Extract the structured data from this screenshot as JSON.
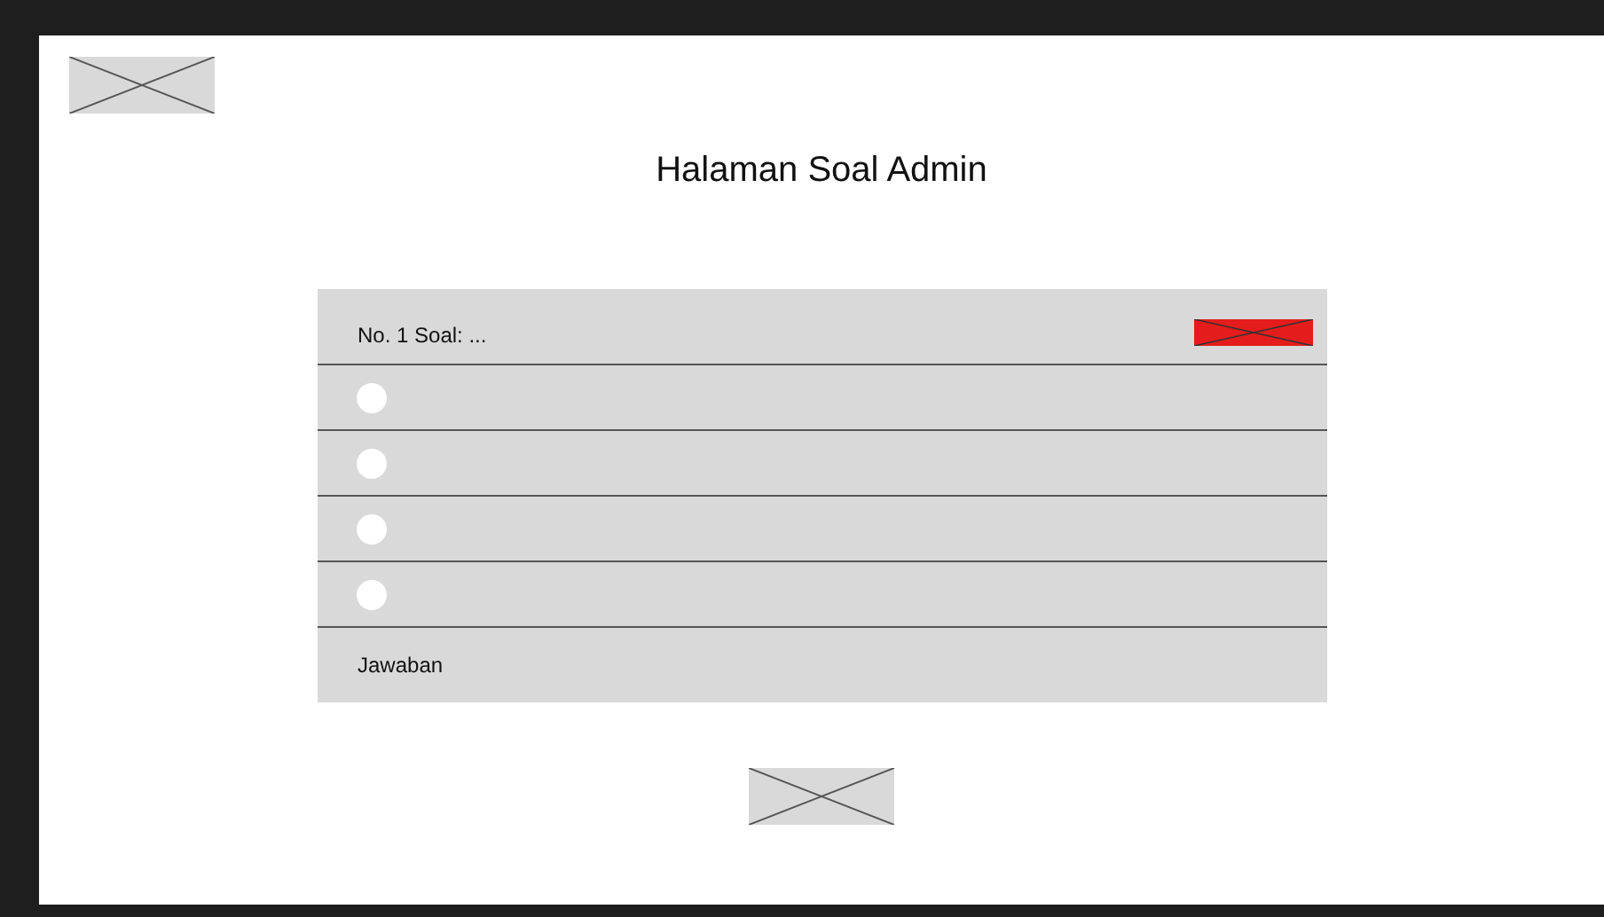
{
  "title": "Halaman Soal Admin",
  "question": {
    "label": "No. 1 Soal: ..."
  },
  "options": [
    {
      "selected": false
    },
    {
      "selected": false
    },
    {
      "selected": false
    },
    {
      "selected": false
    }
  ],
  "answer_label": "Jawaban"
}
